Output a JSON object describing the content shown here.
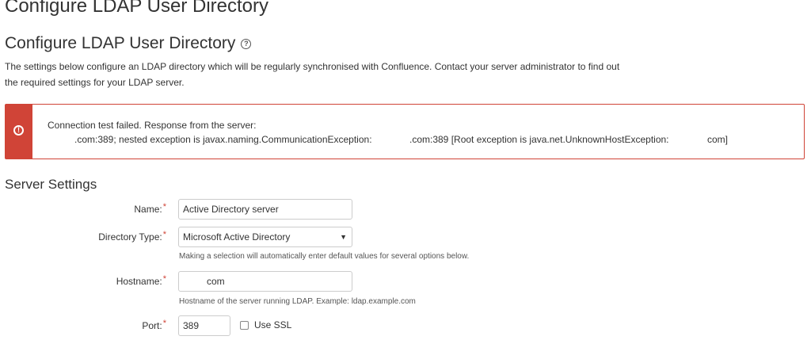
{
  "page": {
    "title": "Configure LDAP User Directory"
  },
  "section": {
    "title": "Configure LDAP User Directory",
    "help_icon": "?",
    "intro_line1": "The settings below configure an LDAP directory which will be regularly synchronised with Confluence. Contact your server administrator to find out",
    "intro_line2": "the required settings for your LDAP server."
  },
  "error": {
    "icon": "!",
    "icon_name": "error-icon",
    "line1": "Connection test failed. Response from the server:",
    "line2_part1": ".com:389; nested exception is javax.naming.CommunicationException:",
    "line2_part2": ".com:389 [Root exception is java.net.UnknownHostException:",
    "line2_part3": "com]",
    "accent_color": "#d04437"
  },
  "server_settings": {
    "title": "Server Settings",
    "name_label": "Name:",
    "name_value": "Active Directory server",
    "directory_type_label": "Directory Type:",
    "directory_type_value": "Microsoft Active Directory",
    "directory_type_hint": "Making a selection will automatically enter default values for several options below.",
    "hostname_label": "Hostname:",
    "hostname_value": "com",
    "hostname_hint": "Hostname of the server running LDAP. Example: ldap.example.com",
    "port_label": "Port:",
    "port_value": "389",
    "use_ssl_label": "Use SSL",
    "use_ssl_checked": false,
    "required_marker": "*"
  }
}
